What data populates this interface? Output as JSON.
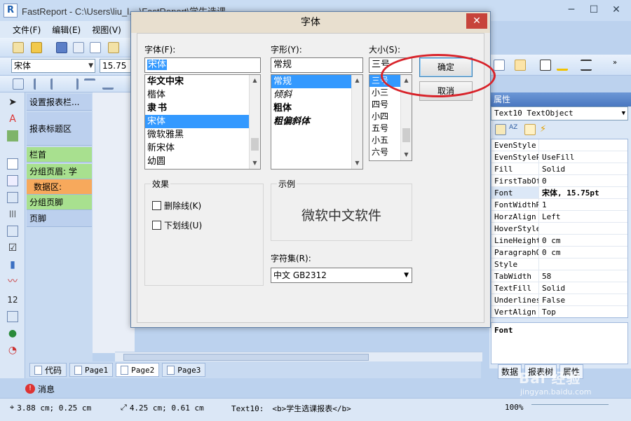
{
  "app": {
    "title": "FastReport - C:\\Users\\liu_l... \\FastReport\\学生选课",
    "menu": [
      "文件(F)",
      "编辑(E)",
      "视图(V)"
    ],
    "font_combo": "宋体",
    "size_combo": "15.75"
  },
  "bands": {
    "items": [
      {
        "label": "设置报表栏...",
        "color": "#bcd0ee"
      },
      {
        "label": "报表标题区",
        "color": "#bcd0ee"
      },
      {
        "label": "栏首",
        "color": "#a8e08f"
      },
      {
        "label": "分组页眉: 学",
        "color": "#a8e08f"
      },
      {
        "label": "数据区:",
        "color": "#f7a95c"
      },
      {
        "label": "分组页脚",
        "color": "#a8e08f"
      },
      {
        "label": "页脚",
        "color": "#bcd0ee"
      }
    ]
  },
  "dialog": {
    "title": "字体",
    "font_label": "字体(F):",
    "font_value": "宋体",
    "font_list": [
      "华文中宋",
      "楷体",
      "隶书",
      "宋体",
      "微软雅黑",
      "新宋体",
      "幼圆"
    ],
    "font_selected": "宋体",
    "style_label": "字形(Y):",
    "style_value": "常规",
    "style_list": [
      "常规",
      "倾斜",
      "粗体",
      "粗偏斜体"
    ],
    "style_selected": "常规",
    "size_label": "大小(S):",
    "size_value": "三号",
    "size_list": [
      "三号",
      "小三",
      "四号",
      "小四",
      "五号",
      "小五",
      "六号"
    ],
    "size_selected": "三号",
    "ok": "确定",
    "cancel": "取消",
    "effects_title": "效果",
    "strike": "删除线(K)",
    "underline": "下划线(U)",
    "sample_title": "示例",
    "sample_text": "微软中文软件",
    "charset_label": "字符集(R):",
    "charset_value": "中文 GB2312"
  },
  "props": {
    "header": "属性",
    "object": "Text10 TextObject",
    "rows": [
      {
        "name": "EvenStyle",
        "value": ""
      },
      {
        "name": "EvenStylePr",
        "value": "UseFill"
      },
      {
        "name": "Fill",
        "value": "Solid"
      },
      {
        "name": "FirstTabOff",
        "value": "0"
      },
      {
        "name": "Font",
        "value": "宋体, 15.75pt"
      },
      {
        "name": "FontWidthRa",
        "value": "1"
      },
      {
        "name": "HorzAlign",
        "value": "Left"
      },
      {
        "name": "HoverStyle",
        "value": ""
      },
      {
        "name": "LineHeight",
        "value": "0 cm"
      },
      {
        "name": "ParagraphOf",
        "value": "0 cm"
      },
      {
        "name": "Style",
        "value": ""
      },
      {
        "name": "TabWidth",
        "value": "58"
      },
      {
        "name": "TextFill",
        "value": "Solid"
      },
      {
        "name": "Underlines",
        "value": "False"
      },
      {
        "name": "VertAlign",
        "value": "Top"
      }
    ],
    "highlight": "Font",
    "desc": "Font",
    "tabs": [
      "数据",
      "报表树",
      "属性"
    ]
  },
  "pages": {
    "tabs": [
      "代码",
      "Page1",
      "Page2",
      "Page3"
    ],
    "active": "Page2"
  },
  "messages": "消息",
  "status": {
    "pos": "3.88 cm; 0.25 cm",
    "size": "4.25 cm; 0.61 cm",
    "obj": "Text10:",
    "text": "<b>学生选课报表</b>",
    "zoom": "100%"
  },
  "watermark": {
    "brand": "Bai 经验",
    "url": "jingyan.baidu.com"
  },
  "colors": {
    "selection": "#3399ff",
    "highlight_circle": "#d8232a",
    "close_button": "#c7443b"
  }
}
